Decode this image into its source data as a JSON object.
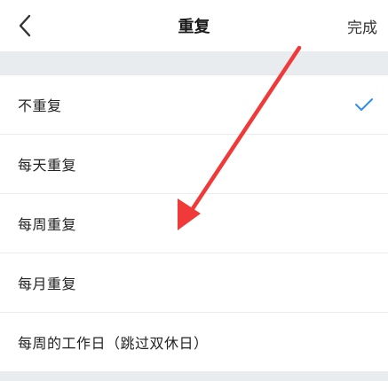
{
  "header": {
    "title": "重复",
    "done_label": "完成",
    "back_icon": "chevron-left-icon"
  },
  "repeat_options": [
    {
      "label": "不重复",
      "selected": true
    },
    {
      "label": "每天重复",
      "selected": false
    },
    {
      "label": "每周重复",
      "selected": false
    },
    {
      "label": "每月重复",
      "selected": false
    },
    {
      "label": "每周的工作日（跳过双休日）",
      "selected": false
    }
  ],
  "colors": {
    "accent_check": "#2f8ef0",
    "annotation_arrow": "#f03a3a",
    "background": "#eef0f3"
  }
}
